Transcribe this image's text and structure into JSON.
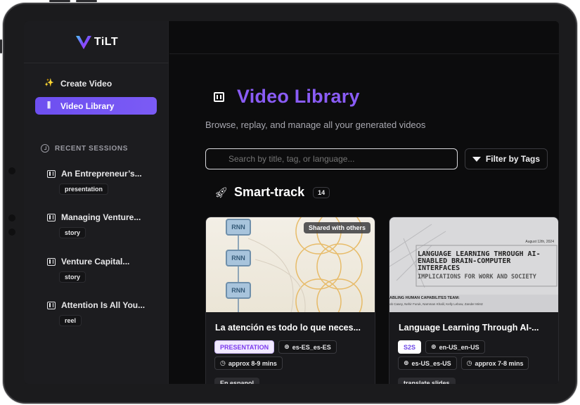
{
  "app": {
    "logo_text": "TiLT"
  },
  "sidebar": {
    "nav": [
      {
        "label": "Create Video",
        "icon": "sparkles-icon"
      },
      {
        "label": "Video Library",
        "icon": "library-icon"
      }
    ],
    "recent_header": "RECENT SESSIONS",
    "sessions": [
      {
        "title": "An Entrepreneur’s...",
        "tag": "presentation"
      },
      {
        "title": "Managing Venture...",
        "tag": "story"
      },
      {
        "title": "Venture Capital...",
        "tag": "story"
      },
      {
        "title": "Attention Is All You...",
        "tag": "reel"
      }
    ]
  },
  "main": {
    "title": "Video Library",
    "subtitle": "Browse, replay, and manage all your generated videos",
    "search": {
      "placeholder": "Search by title, tag, or language..."
    },
    "filter_label": "Filter by Tags",
    "section": {
      "title": "Smart-track",
      "count": "14"
    },
    "cards": [
      {
        "badge": "Shared with others",
        "thumb_labels": [
          "RNN",
          "RNN",
          "RNN"
        ],
        "title": "La atención es todo lo que neces...",
        "chips_row1": [
          "PRESENTATION",
          "es-ES_es-ES"
        ],
        "chips_row2": [
          "approx 8-9 mins"
        ],
        "bottom_tag": "En espanol"
      },
      {
        "thumb_date": "August 12th, 2024",
        "thumb_heading": "LANGUAGE LEARNING THROUGH AI-ENABLED BRAIN-COMPUTER INTERFACES",
        "thumb_subheading": "IMPLICATIONS FOR WORK AND SOCIETY",
        "thumb_team": "ABLING HUMAN CAPABILITES TEAM:",
        "thumb_names": "ob Casey, Nehir Furuk, Namman Khalil, Kelly Lebow, Zander Mintz",
        "title": "Language Learning Through AI-...",
        "chips_row1": [
          "S2S",
          "en-US_en-US"
        ],
        "chips_row2": [
          "es-US_es-US",
          "approx 7-8 mins"
        ],
        "bottom_tag": "translate slides"
      }
    ]
  },
  "colors": {
    "accent": "#7b5bf5",
    "title_purple": "#8a5cf6"
  }
}
